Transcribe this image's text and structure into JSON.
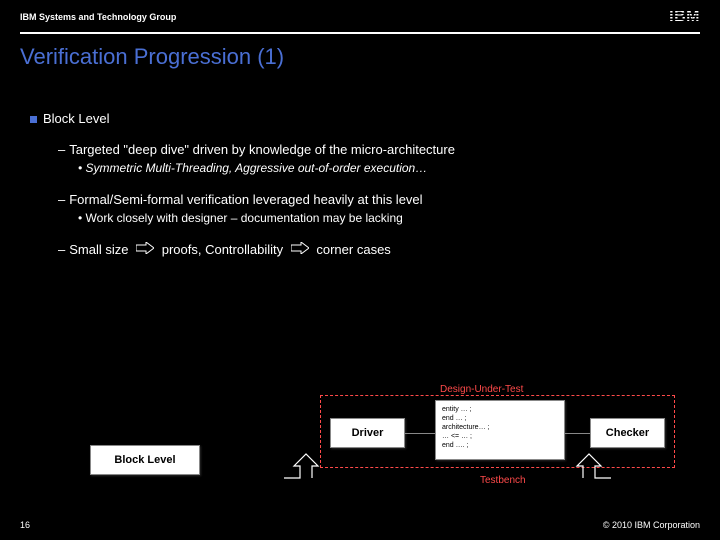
{
  "header": {
    "group": "IBM Systems and Technology Group",
    "logo": "IBM"
  },
  "slide": {
    "title": "Verification Progression (1)",
    "b1": "Block Level",
    "b2a": "Targeted \"deep dive\" driven by knowledge of the micro-architecture",
    "b3a": "Symmetric Multi-Threading, Aggressive out-of-order execution…",
    "b2b": "Formal/Semi-formal verification leveraged heavily at this level",
    "b3b": "Work closely with designer – documentation may be lacking",
    "b2c_pre": "Small size",
    "b2c_mid": "proofs, Controllability",
    "b2c_post": "corner cases"
  },
  "diagram": {
    "blocklevel": "Block Level",
    "driver": "Driver",
    "checker": "Checker",
    "dut_label": "Design-Under-Test",
    "tb_label": "Testbench",
    "dut_code": "entity … ;\nend … ;\narchitecture… ;\n… <= … ;\nend …. ;"
  },
  "footer": {
    "page": "16",
    "copyright": "© 2010 IBM Corporation"
  }
}
